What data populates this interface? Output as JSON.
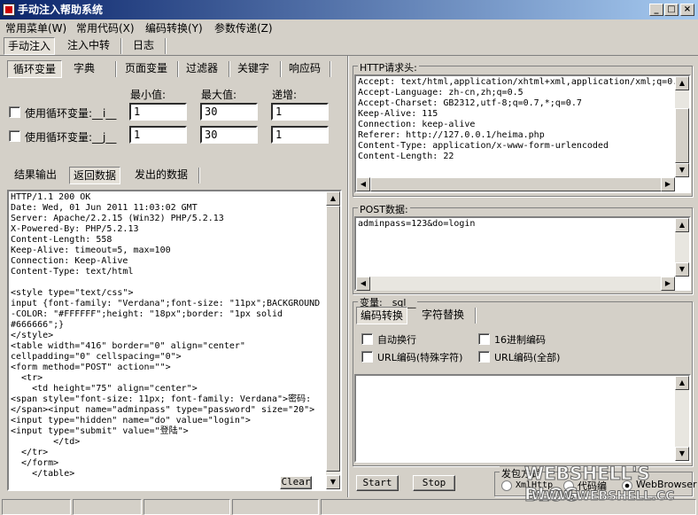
{
  "window": {
    "title": "手动注入帮助系统"
  },
  "menu": [
    "常用菜单(W)",
    "常用代码(X)",
    "编码转换(Y)",
    "参数传递(Z)"
  ],
  "main_tabs": [
    "手动注入",
    "注入中转",
    "日志"
  ],
  "sub_tabs": [
    "循环变量",
    "字典",
    "页面变量",
    "过滤器",
    "关键字",
    "响应码"
  ],
  "loop": {
    "min_label": "最小值:",
    "max_label": "最大值:",
    "step_label": "递增:",
    "rows": [
      {
        "label": "使用循环变量:__i__",
        "min": "1",
        "max": "30",
        "step": "1"
      },
      {
        "label": "使用循环变量:__j__",
        "min": "1",
        "max": "30",
        "step": "1"
      }
    ]
  },
  "result_tabs": [
    "结果输出",
    "返回数据",
    "发出的数据"
  ],
  "response_text": "HTTP/1.1 200 OK\nDate: Wed, 01 Jun 2011 11:03:02 GMT\nServer: Apache/2.2.15 (Win32) PHP/5.2.13\nX-Powered-By: PHP/5.2.13\nContent-Length: 558\nKeep-Alive: timeout=5, max=100\nConnection: Keep-Alive\nContent-Type: text/html\n\n<style type=\"text/css\">\ninput {font-family: \"Verdana\";font-size: \"11px\";BACKGROUND\n-COLOR: \"#FFFFFF\";height: \"18px\";border: \"1px solid\n#666666\";}\n</style>\n<table width=\"416\" border=\"0\" align=\"center\"\ncellpadding=\"0\" cellspacing=\"0\">\n<form method=\"POST\" action=\"\">\n  <tr>\n    <td height=\"75\" align=\"center\">\n<span style=\"font-size: 11px; font-family: Verdana\">密码:\n</span><input name=\"adminpass\" type=\"password\" size=\"20\">\n<input type=\"hidden\" name=\"do\" value=\"login\">\n<input type=\"submit\" value=\"登陆\">\n        </td>\n  </tr>\n  </form>\n    </table>",
  "clear_button": "Clear",
  "http_header": {
    "label": "HTTP请求头:",
    "text": "Accept: text/html,application/xhtml+xml,application/xml;q=0.\nAccept-Language: zh-cn,zh;q=0.5\nAccept-Charset: GB2312,utf-8;q=0.7,*;q=0.7\nKeep-Alive: 115\nConnection: keep-alive\nReferer: http://127.0.0.1/heima.php\nContent-Type: application/x-www-form-urlencoded\nContent-Length: 22"
  },
  "post_data": {
    "label": "POST数据:",
    "text": "adminpass=123&do=login"
  },
  "variable_label": "变量:__sql__",
  "encode_tabs": [
    "编码转换",
    "字符替换"
  ],
  "encode_options": [
    "自动换行",
    "16进制编码",
    "URL编码(特殊字符)",
    "URL编码(全部)"
  ],
  "buttons": {
    "start": "Start",
    "stop": "Stop"
  },
  "send_method": {
    "label": "发包方式",
    "options": [
      "XmlHttp",
      "代码编",
      "WebBrowser"
    ]
  },
  "watermark": {
    "line1": "WEBSHELL'S BLOG",
    "line2": "WWW.WEBSHELL.CC"
  }
}
